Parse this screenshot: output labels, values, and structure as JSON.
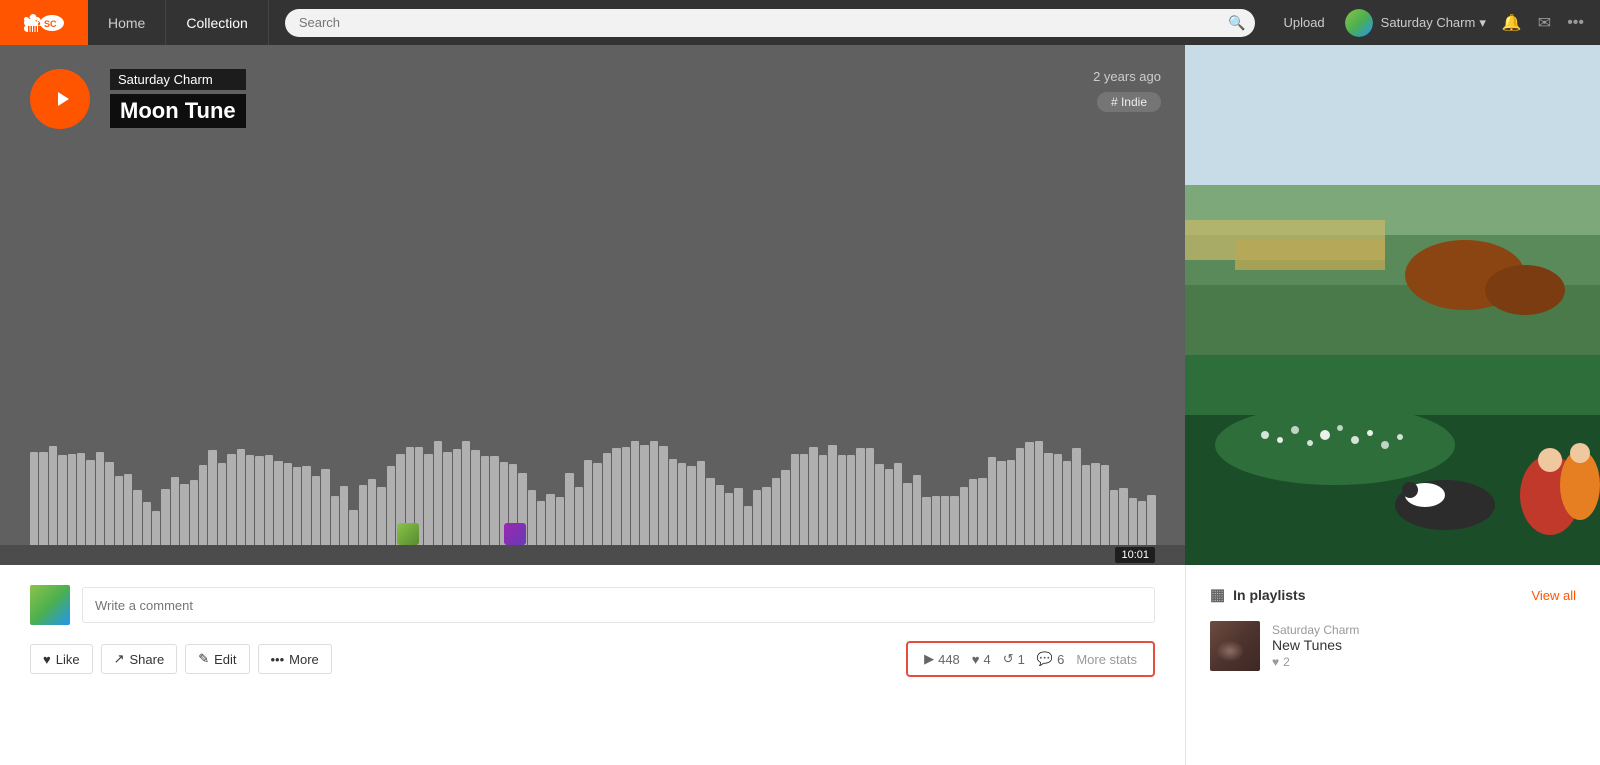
{
  "navbar": {
    "home_label": "Home",
    "collection_label": "Collection",
    "search_placeholder": "Search",
    "upload_label": "Upload",
    "username": "Saturday Charm",
    "chevron": "▾",
    "bell_icon": "🔔",
    "mail_icon": "✉",
    "more_icon": "•••"
  },
  "player": {
    "artist": "Saturday Charm",
    "title": "Moon Tune",
    "time_ago": "2 years ago",
    "tag": "# Indie",
    "duration": "10:01"
  },
  "stats": {
    "play_count": "448",
    "like_count": "4",
    "repost_count": "1",
    "comment_count": "6",
    "more_stats_label": "More stats"
  },
  "actions": {
    "like_label": "Like",
    "share_label": "Share",
    "edit_label": "Edit",
    "more_label": "More"
  },
  "comment": {
    "placeholder": "Write a comment"
  },
  "playlists": {
    "section_title": "In playlists",
    "view_all": "View all",
    "item": {
      "artist": "Saturday Charm",
      "name": "New Tunes",
      "likes": "2"
    }
  }
}
